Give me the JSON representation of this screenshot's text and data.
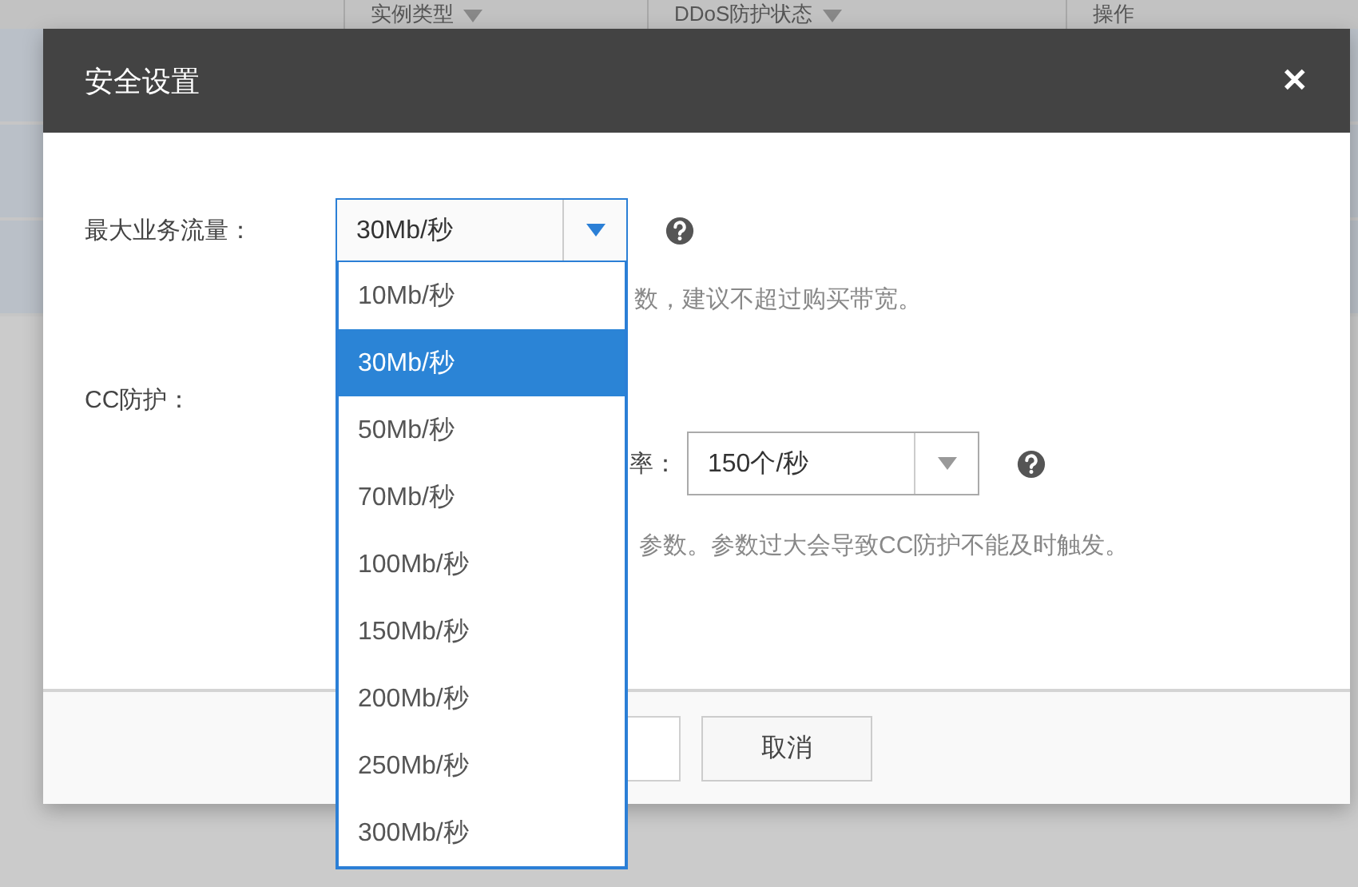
{
  "background_table": {
    "columns": [
      {
        "label": "实例类型",
        "kind": "sortable"
      },
      {
        "label": "DDoS防护状态",
        "kind": "sortable"
      },
      {
        "label": "操作",
        "kind": "plain"
      }
    ]
  },
  "dialog": {
    "title": "安全设置",
    "close": "✕",
    "max_traffic": {
      "label": "最大业务流量：",
      "value": "30Mb/秒",
      "hint": "数，建议不超过购买带宽。",
      "expanded": true,
      "options": [
        {
          "label": "10Mb/秒",
          "selected": false
        },
        {
          "label": "30Mb/秒",
          "selected": true
        },
        {
          "label": "50Mb/秒",
          "selected": false
        },
        {
          "label": "70Mb/秒",
          "selected": false
        },
        {
          "label": "100Mb/秒",
          "selected": false
        },
        {
          "label": "150Mb/秒",
          "selected": false
        },
        {
          "label": "200Mb/秒",
          "selected": false
        },
        {
          "label": "250Mb/秒",
          "selected": false
        },
        {
          "label": "300Mb/秒",
          "selected": false
        }
      ]
    },
    "cc": {
      "label": "CC防护：",
      "rate_label": "率：",
      "rate_value": "150个/秒",
      "hint": "参数。参数过大会导致CC防护不能及时触发。"
    },
    "buttons": [
      {
        "kind": "primary"
      },
      {
        "label": "取消",
        "kind": "default"
      }
    ]
  }
}
